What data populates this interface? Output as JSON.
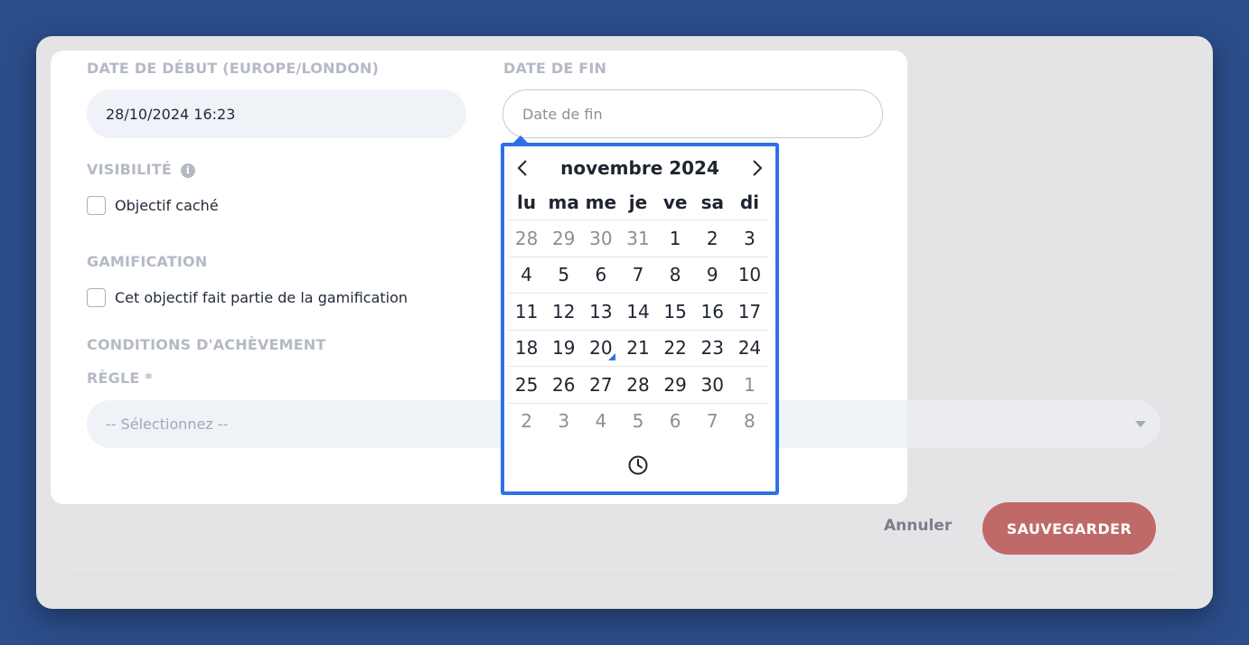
{
  "form": {
    "start_date_label": "DATE DE DÉBUT (EUROPE/LONDON)",
    "start_date_value": "28/10/2024 16:23",
    "end_date_label": "DATE DE FIN",
    "end_date_placeholder": "Date de fin",
    "visibility_label": "VISIBILITÉ",
    "visibility_info": "i",
    "hidden_goal_label": "Objectif caché",
    "gamification_label": "GAMIFICATION",
    "gamification_checkbox_label": "Cet objectif fait partie de la gamification",
    "conditions_label": "CONDITIONS D'ACHÈVEMENT",
    "rule_label": "RÈGLE *",
    "rule_placeholder": "-- Sélectionnez --"
  },
  "actions": {
    "cancel_label": "Annuler",
    "save_label": "SAUVEGARDER"
  },
  "datepicker": {
    "month_title": "novembre 2024",
    "weekdays": [
      "lu",
      "ma",
      "me",
      "je",
      "ve",
      "sa",
      "di"
    ],
    "weeks": [
      [
        {
          "d": "28",
          "m": true
        },
        {
          "d": "29",
          "m": true
        },
        {
          "d": "30",
          "m": true
        },
        {
          "d": "31",
          "m": true
        },
        {
          "d": "1"
        },
        {
          "d": "2"
        },
        {
          "d": "3"
        }
      ],
      [
        {
          "d": "4"
        },
        {
          "d": "5"
        },
        {
          "d": "6"
        },
        {
          "d": "7"
        },
        {
          "d": "8"
        },
        {
          "d": "9"
        },
        {
          "d": "10"
        }
      ],
      [
        {
          "d": "11"
        },
        {
          "d": "12"
        },
        {
          "d": "13"
        },
        {
          "d": "14"
        },
        {
          "d": "15"
        },
        {
          "d": "16"
        },
        {
          "d": "17"
        }
      ],
      [
        {
          "d": "18"
        },
        {
          "d": "19"
        },
        {
          "d": "20",
          "today": true
        },
        {
          "d": "21"
        },
        {
          "d": "22"
        },
        {
          "d": "23"
        },
        {
          "d": "24"
        }
      ],
      [
        {
          "d": "25"
        },
        {
          "d": "26"
        },
        {
          "d": "27"
        },
        {
          "d": "28"
        },
        {
          "d": "29"
        },
        {
          "d": "30"
        },
        {
          "d": "1",
          "m": true
        }
      ],
      [
        {
          "d": "2",
          "m": true
        },
        {
          "d": "3",
          "m": true
        },
        {
          "d": "4",
          "m": true
        },
        {
          "d": "5",
          "m": true
        },
        {
          "d": "6",
          "m": true
        },
        {
          "d": "7",
          "m": true
        },
        {
          "d": "8",
          "m": true
        }
      ]
    ],
    "icons": {
      "prev": "chevron-left-icon",
      "next": "chevron-right-icon",
      "time": "clock-icon"
    }
  },
  "colors": {
    "accent": "#2f6fe8",
    "save_button": "#bf6a68",
    "background": "#2b4d8a"
  }
}
